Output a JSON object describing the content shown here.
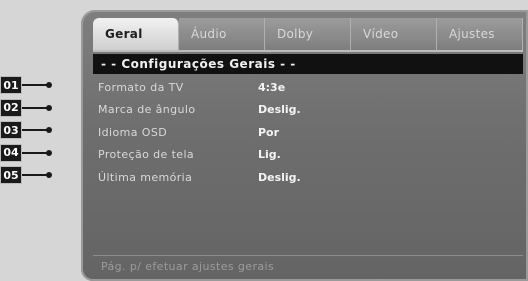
{
  "tabs": [
    {
      "label": "Geral",
      "active": true
    },
    {
      "label": "Áudio",
      "active": false
    },
    {
      "label": "Dolby",
      "active": false
    },
    {
      "label": "Vídeo",
      "active": false
    },
    {
      "label": "Ajustes",
      "active": false
    }
  ],
  "section_title": "- - Configurações Gerais - -",
  "rows": [
    {
      "marker": "01",
      "label": "Formato da TV",
      "value": "4:3e"
    },
    {
      "marker": "02",
      "label": "Marca de ângulo",
      "value": "Deslig."
    },
    {
      "marker": "03",
      "label": "Idioma OSD",
      "value": "Por"
    },
    {
      "marker": "04",
      "label": "Proteção de tela",
      "value": "Lig."
    },
    {
      "marker": "05",
      "label": "Última memória",
      "value": "Deslig."
    }
  ],
  "status_text": "Pág. p/ efetuar ajustes gerais"
}
